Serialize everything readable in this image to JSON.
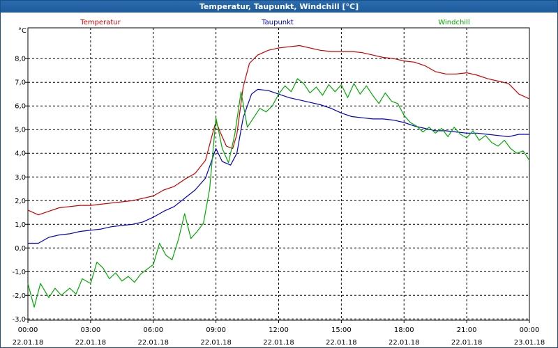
{
  "window": {
    "title": "Temperatur, Taupunkt, Windchill [°C]"
  },
  "chart_data": {
    "type": "line",
    "title": "Temperatur, Taupunkt, Windchill [°C]",
    "ylabel": "°C",
    "ylim": [
      -3.05,
      9.3
    ],
    "y_ticks": [
      "-3,0",
      "-2,0",
      "-1,0",
      "0,0",
      "1,0",
      "2,0",
      "3,0",
      "4,0",
      "5,0",
      "6,0",
      "7,0",
      "8,0"
    ],
    "x_range_hours": [
      0,
      24
    ],
    "x_ticks": [
      {
        "time": "00:00",
        "date": "22.01.18"
      },
      {
        "time": "03:00",
        "date": "22.01.18"
      },
      {
        "time": "06:00",
        "date": "22.01.18"
      },
      {
        "time": "09:00",
        "date": "22.01.18"
      },
      {
        "time": "12:00",
        "date": "22.01.18"
      },
      {
        "time": "15:00",
        "date": "22.01.18"
      },
      {
        "time": "18:00",
        "date": "22.01.18"
      },
      {
        "time": "21:00",
        "date": "22.01.18"
      },
      {
        "time": "00:00",
        "date": "23.01.18"
      }
    ],
    "grid": true,
    "series": [
      {
        "name": "Temperatur",
        "color": "#cc0000",
        "points": [
          [
            0,
            1.6
          ],
          [
            0.5,
            1.4
          ],
          [
            1,
            1.55
          ],
          [
            1.5,
            1.7
          ],
          [
            2,
            1.75
          ],
          [
            2.5,
            1.8
          ],
          [
            3,
            1.8
          ],
          [
            3.5,
            1.85
          ],
          [
            4,
            1.9
          ],
          [
            4.5,
            1.95
          ],
          [
            5,
            2.0
          ],
          [
            5.5,
            2.1
          ],
          [
            6,
            2.2
          ],
          [
            6.5,
            2.45
          ],
          [
            7,
            2.6
          ],
          [
            7.5,
            2.9
          ],
          [
            8,
            3.15
          ],
          [
            8.5,
            3.7
          ],
          [
            8.8,
            4.7
          ],
          [
            9,
            5.35
          ],
          [
            9.2,
            4.9
          ],
          [
            9.5,
            4.3
          ],
          [
            9.8,
            4.2
          ],
          [
            10,
            4.8
          ],
          [
            10.3,
            6.8
          ],
          [
            10.6,
            7.8
          ],
          [
            11,
            8.15
          ],
          [
            11.5,
            8.35
          ],
          [
            12,
            8.45
          ],
          [
            12.5,
            8.5
          ],
          [
            13,
            8.55
          ],
          [
            13.5,
            8.45
          ],
          [
            14,
            8.35
          ],
          [
            14.5,
            8.3
          ],
          [
            15,
            8.3
          ],
          [
            15.5,
            8.3
          ],
          [
            16,
            8.25
          ],
          [
            16.5,
            8.15
          ],
          [
            17,
            8.05
          ],
          [
            17.5,
            8.0
          ],
          [
            18,
            7.9
          ],
          [
            18.5,
            7.85
          ],
          [
            19,
            7.7
          ],
          [
            19.5,
            7.45
          ],
          [
            20,
            7.35
          ],
          [
            20.5,
            7.35
          ],
          [
            21,
            7.4
          ],
          [
            21.5,
            7.3
          ],
          [
            22,
            7.15
          ],
          [
            22.5,
            7.05
          ],
          [
            23,
            6.95
          ],
          [
            23.5,
            6.5
          ],
          [
            24,
            6.3
          ]
        ]
      },
      {
        "name": "Taupunkt",
        "color": "#0000cc",
        "points": [
          [
            0,
            0.2
          ],
          [
            0.5,
            0.2
          ],
          [
            1,
            0.45
          ],
          [
            1.5,
            0.55
          ],
          [
            2,
            0.6
          ],
          [
            2.5,
            0.7
          ],
          [
            3,
            0.75
          ],
          [
            3.5,
            0.8
          ],
          [
            4,
            0.9
          ],
          [
            4.5,
            0.95
          ],
          [
            5,
            1.0
          ],
          [
            5.5,
            1.1
          ],
          [
            6,
            1.3
          ],
          [
            6.5,
            1.55
          ],
          [
            7,
            1.75
          ],
          [
            7.5,
            2.1
          ],
          [
            8,
            2.45
          ],
          [
            8.5,
            2.95
          ],
          [
            9,
            4.2
          ],
          [
            9.3,
            3.65
          ],
          [
            9.7,
            3.5
          ],
          [
            10,
            4.0
          ],
          [
            10.3,
            5.5
          ],
          [
            10.7,
            6.5
          ],
          [
            11,
            6.7
          ],
          [
            11.5,
            6.65
          ],
          [
            12,
            6.5
          ],
          [
            12.5,
            6.35
          ],
          [
            13,
            6.25
          ],
          [
            13.5,
            6.15
          ],
          [
            14,
            6.05
          ],
          [
            14.5,
            5.9
          ],
          [
            15,
            5.7
          ],
          [
            15.5,
            5.55
          ],
          [
            16,
            5.5
          ],
          [
            16.5,
            5.45
          ],
          [
            17,
            5.45
          ],
          [
            17.5,
            5.4
          ],
          [
            18,
            5.3
          ],
          [
            18.5,
            5.15
          ],
          [
            19,
            5.05
          ],
          [
            19.5,
            4.95
          ],
          [
            20,
            4.95
          ],
          [
            20.5,
            4.9
          ],
          [
            21,
            4.85
          ],
          [
            21.5,
            4.85
          ],
          [
            22,
            4.8
          ],
          [
            22.5,
            4.75
          ],
          [
            23,
            4.7
          ],
          [
            23.5,
            4.8
          ],
          [
            24,
            4.8
          ]
        ]
      },
      {
        "name": "Windchill",
        "color": "#00aa00",
        "points": [
          [
            0,
            -1.5
          ],
          [
            0.3,
            -2.5
          ],
          [
            0.6,
            -1.5
          ],
          [
            1,
            -2.1
          ],
          [
            1.3,
            -1.7
          ],
          [
            1.6,
            -2.0
          ],
          [
            2,
            -1.7
          ],
          [
            2.3,
            -1.95
          ],
          [
            2.6,
            -1.3
          ],
          [
            3,
            -1.5
          ],
          [
            3.3,
            -0.6
          ],
          [
            3.6,
            -0.85
          ],
          [
            3.9,
            -1.3
          ],
          [
            4.2,
            -1.05
          ],
          [
            4.5,
            -1.4
          ],
          [
            4.8,
            -1.2
          ],
          [
            5.1,
            -1.45
          ],
          [
            5.4,
            -1.1
          ],
          [
            5.7,
            -0.9
          ],
          [
            6,
            -0.7
          ],
          [
            6.3,
            0.2
          ],
          [
            6.6,
            -0.3
          ],
          [
            6.9,
            -0.5
          ],
          [
            7.2,
            0.35
          ],
          [
            7.5,
            1.45
          ],
          [
            7.8,
            0.4
          ],
          [
            8.1,
            0.7
          ],
          [
            8.4,
            1.05
          ],
          [
            8.7,
            2.5
          ],
          [
            9,
            5.5
          ],
          [
            9.3,
            4.2
          ],
          [
            9.6,
            3.6
          ],
          [
            9.9,
            4.8
          ],
          [
            10.2,
            6.6
          ],
          [
            10.5,
            5.1
          ],
          [
            10.8,
            5.5
          ],
          [
            11.1,
            5.9
          ],
          [
            11.4,
            5.75
          ],
          [
            11.7,
            6.0
          ],
          [
            12,
            6.5
          ],
          [
            12.3,
            6.85
          ],
          [
            12.6,
            6.6
          ],
          [
            12.9,
            7.15
          ],
          [
            13.2,
            6.95
          ],
          [
            13.5,
            6.55
          ],
          [
            13.8,
            6.8
          ],
          [
            14.1,
            6.45
          ],
          [
            14.4,
            6.9
          ],
          [
            14.7,
            6.6
          ],
          [
            15,
            6.9
          ],
          [
            15.3,
            6.35
          ],
          [
            15.6,
            6.95
          ],
          [
            15.9,
            6.5
          ],
          [
            16.2,
            6.85
          ],
          [
            16.5,
            6.45
          ],
          [
            16.8,
            6.1
          ],
          [
            17.1,
            6.55
          ],
          [
            17.4,
            6.2
          ],
          [
            17.7,
            6.1
          ],
          [
            18,
            5.6
          ],
          [
            18.3,
            5.3
          ],
          [
            18.6,
            5.15
          ],
          [
            18.9,
            4.9
          ],
          [
            19.2,
            5.1
          ],
          [
            19.5,
            4.85
          ],
          [
            19.8,
            5.05
          ],
          [
            20.1,
            4.7
          ],
          [
            20.4,
            5.1
          ],
          [
            20.7,
            4.8
          ],
          [
            21,
            4.65
          ],
          [
            21.3,
            4.95
          ],
          [
            21.6,
            4.55
          ],
          [
            21.9,
            4.75
          ],
          [
            22.2,
            4.45
          ],
          [
            22.5,
            4.3
          ],
          [
            22.8,
            4.55
          ],
          [
            23.1,
            4.2
          ],
          [
            23.4,
            4.0
          ],
          [
            23.7,
            4.1
          ],
          [
            24,
            3.7
          ]
        ]
      }
    ]
  }
}
